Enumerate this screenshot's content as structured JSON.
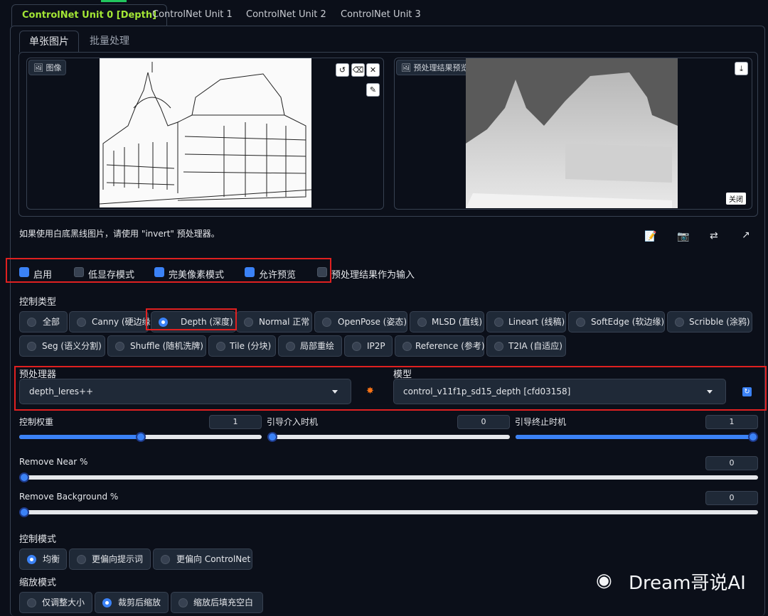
{
  "unit_tabs": [
    "ControlNet Unit 0 [Depth]",
    "ControlNet Unit 1",
    "ControlNet Unit 2",
    "ControlNet Unit 3"
  ],
  "sub_tabs": [
    "单张图片",
    "批量处理"
  ],
  "image_panel": {
    "label": "图像"
  },
  "preview_panel": {
    "label": "预处理结果预览",
    "close_label": "关闭"
  },
  "hint": "如果使用白底黑线图片，请使用 \"invert\" 预处理器。",
  "toolbar_icons": [
    "note-icon",
    "camera-icon",
    "swap-icon",
    "send-icon"
  ],
  "options": [
    {
      "label": "启用",
      "checked": true
    },
    {
      "label": "低显存模式",
      "checked": false
    },
    {
      "label": "完美像素模式",
      "checked": true
    },
    {
      "label": "允许预览",
      "checked": true
    },
    {
      "label": "预处理结果作为输入",
      "checked": false
    }
  ],
  "control_type": {
    "title": "控制类型",
    "items": [
      "全部",
      "Canny (硬边缘)",
      "Depth (深度)",
      "Normal 正常",
      "OpenPose (姿态)",
      "MLSD (直线)",
      "Lineart (线稿)",
      "SoftEdge (软边缘)",
      "Scribble (涂鸦)",
      "Seg (语义分割)",
      "Shuffle (随机洗牌)",
      "Tile (分块)",
      "局部重绘",
      "IP2P",
      "Reference (参考)",
      "T2IA (自适应)"
    ],
    "selected": "Depth (深度)"
  },
  "preprocessor": {
    "label": "预处理器",
    "value": "depth_leres++"
  },
  "model": {
    "label": "模型",
    "value": "control_v11f1p_sd15_depth [cfd03158]"
  },
  "sliders": {
    "weight": {
      "label": "控制权重",
      "value": "1",
      "fraction": 0.5
    },
    "start": {
      "label": "引导介入时机",
      "value": "0",
      "fraction": 0.0
    },
    "end": {
      "label": "引导终止时机",
      "value": "1",
      "fraction": 1.0
    },
    "remove_near": {
      "label": "Remove Near %",
      "value": "0",
      "fraction": 0.0
    },
    "remove_bg": {
      "label": "Remove Background %",
      "value": "0",
      "fraction": 0.0
    }
  },
  "control_mode": {
    "title": "控制模式",
    "items": [
      "均衡",
      "更偏向提示词",
      "更偏向 ControlNet"
    ],
    "selected": "均衡"
  },
  "resize_mode": {
    "title": "缩放模式",
    "items": [
      "仅调整大小",
      "裁剪后缩放",
      "缩放后填充空白"
    ],
    "selected": "裁剪后缩放"
  },
  "watermark": "Dream哥说AI",
  "colors": {
    "accent": "#3b82f6",
    "active_tab": "#a3e635",
    "highlight_box": "#e02020",
    "background": "#0b0f19"
  }
}
